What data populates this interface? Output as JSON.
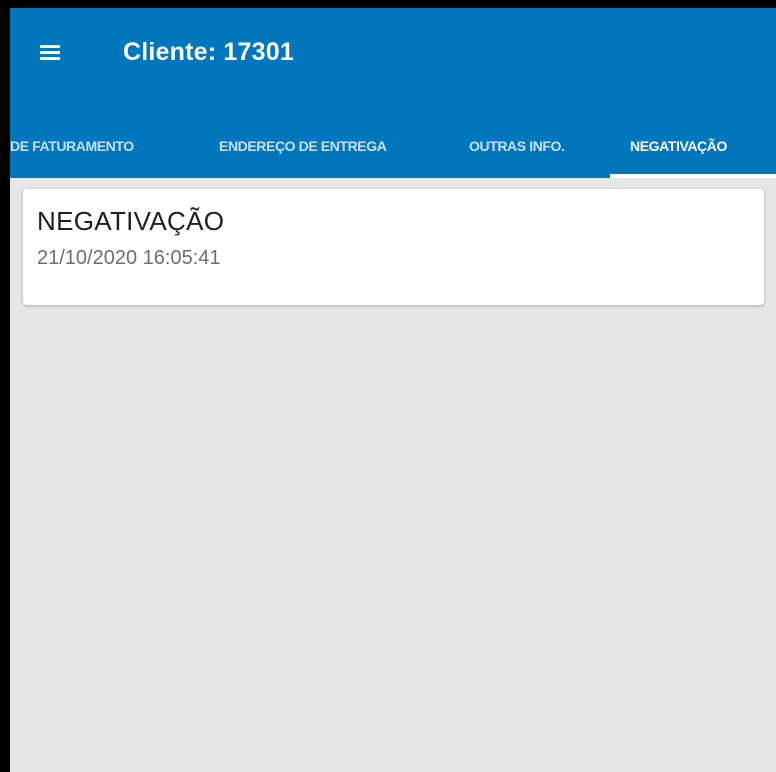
{
  "toolbar": {
    "title": "Cliente: 17301",
    "menu_icon": "hamburger-menu-icon"
  },
  "tabs": [
    {
      "label": "DE FATURAMENTO",
      "active": false
    },
    {
      "label": "ENDEREÇO DE ENTREGA",
      "active": false
    },
    {
      "label": "OUTRAS INFO.",
      "active": false
    },
    {
      "label": "NEGATIVAÇÃO",
      "active": true
    }
  ],
  "cards": [
    {
      "title": "NEGATIVAÇÃO",
      "subtitle": "21/10/2020 16:05:41"
    }
  ],
  "colors": {
    "app_bar": "#0277bd",
    "background": "#e6e6e6",
    "card": "#ffffff",
    "frame": "#000000"
  }
}
